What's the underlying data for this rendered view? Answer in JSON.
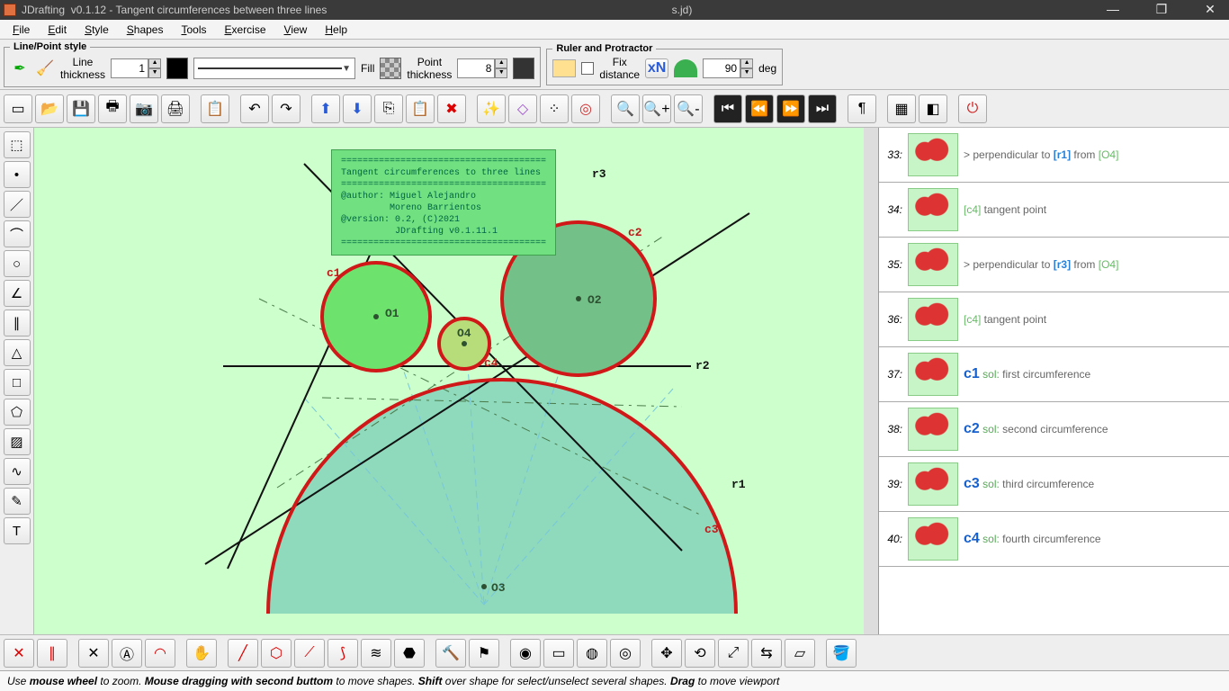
{
  "window": {
    "app_name": "JDrafting",
    "version": "v0.1.12",
    "doc_title": "Tangent circumferences between three lines",
    "file_suffix": "s.jd)"
  },
  "menus": [
    "File",
    "Edit",
    "Style",
    "Shapes",
    "Tools",
    "Exercise",
    "View",
    "Help"
  ],
  "line_point_style": {
    "legend": "Line/Point style",
    "thickness_label": "Line\nthickness",
    "thickness_value": "1",
    "color": "#000000",
    "fill_label": "Fill",
    "point_thickness_label": "Point\nthickness",
    "point_thickness_value": "8",
    "point_color": "#333333"
  },
  "ruler_protractor": {
    "legend": "Ruler and Protractor",
    "fix_distance_label": "Fix\ndistance",
    "xn_label": "xN",
    "angle_value": "90",
    "angle_unit": "deg"
  },
  "main_toolbar_icons": [
    {
      "name": "new-icon",
      "glyph": "▭"
    },
    {
      "name": "open-icon",
      "glyph": "📂"
    },
    {
      "name": "save-icon",
      "glyph": "💾"
    },
    {
      "name": "print-icon",
      "glyph": "🖶"
    },
    {
      "name": "camera-icon",
      "glyph": "📷"
    },
    {
      "name": "printer2-icon",
      "glyph": "🖨"
    },
    {
      "sep": true
    },
    {
      "name": "paste-icon",
      "glyph": "📋"
    },
    {
      "sep": true
    },
    {
      "name": "undo-icon",
      "glyph": "↶"
    },
    {
      "name": "redo-icon",
      "glyph": "↷"
    },
    {
      "sep": true
    },
    {
      "name": "up-icon",
      "glyph": "⬆",
      "color": "#2a5bd7"
    },
    {
      "name": "down-icon",
      "glyph": "⬇",
      "color": "#2a5bd7"
    },
    {
      "name": "copy-icon",
      "glyph": "⎘"
    },
    {
      "name": "clipboard-icon",
      "glyph": "📋"
    },
    {
      "name": "delete-icon",
      "glyph": "✖",
      "color": "#d00"
    },
    {
      "sep": true
    },
    {
      "name": "wand-icon",
      "glyph": "✨"
    },
    {
      "name": "diamond-icon",
      "glyph": "◇",
      "color": "#a050d0"
    },
    {
      "name": "dots-icon",
      "glyph": "⁘"
    },
    {
      "name": "target-icon",
      "glyph": "◎",
      "color": "#d03030"
    },
    {
      "sep": true
    },
    {
      "name": "zoom-fit-icon",
      "glyph": "🔍"
    },
    {
      "name": "zoom-in-icon",
      "glyph": "🔍+"
    },
    {
      "name": "zoom-out-icon",
      "glyph": "🔍-"
    },
    {
      "sep": true
    },
    {
      "name": "first-icon",
      "glyph": "⏮",
      "dark": true
    },
    {
      "name": "prev-icon",
      "glyph": "⏪",
      "dark": true
    },
    {
      "name": "next-icon",
      "glyph": "⏩",
      "dark": true
    },
    {
      "name": "last-icon",
      "glyph": "⏭",
      "dark": true
    },
    {
      "sep": true
    },
    {
      "name": "pilcrow-icon",
      "glyph": "¶"
    },
    {
      "sep": true
    },
    {
      "name": "select-all-icon",
      "glyph": "▦"
    },
    {
      "name": "invert-icon",
      "glyph": "◧"
    },
    {
      "sep": true
    },
    {
      "name": "power-icon",
      "glyph": "⏻",
      "color": "#d02020"
    }
  ],
  "left_tools": [
    {
      "name": "selection-icon",
      "glyph": "⬚"
    },
    {
      "name": "point-icon",
      "glyph": "•"
    },
    {
      "name": "line-icon",
      "glyph": "／"
    },
    {
      "name": "arc-icon",
      "glyph": "⌒"
    },
    {
      "name": "circle-icon",
      "glyph": "○"
    },
    {
      "name": "angle-icon",
      "glyph": "∠"
    },
    {
      "name": "parallel-icon",
      "glyph": "∥"
    },
    {
      "name": "triangle-icon",
      "glyph": "△"
    },
    {
      "name": "square-icon",
      "glyph": "□"
    },
    {
      "name": "polygon-icon",
      "glyph": "⬠"
    },
    {
      "name": "hatch-icon",
      "glyph": "▨"
    },
    {
      "name": "spline-icon",
      "glyph": "∿"
    },
    {
      "name": "pencil-icon",
      "glyph": "✎"
    },
    {
      "name": "text-icon",
      "glyph": "T"
    }
  ],
  "infobox_text": "======================================\nTangent circumferences to three lines\n======================================\n@author: Miguel Alejandro\n         Moreno Barrientos\n@version: 0.2, (C)2021\n          JDrafting v0.1.11.1\n======================================",
  "canvas_labels": {
    "o1": "O1",
    "o2": "O2",
    "o3": "O3",
    "o4": "O4",
    "c1": "c1",
    "c2": "c2",
    "c3": "c3",
    "c4": "c4",
    "r1": "r1",
    "r2": "r2",
    "r3": "r3"
  },
  "steps": [
    {
      "n": "33",
      "kind": "perp",
      "text1": "> perpendicular to ",
      "ref": "[r1]",
      "text2": " from ",
      "src": "[O4]"
    },
    {
      "n": "34",
      "kind": "tan",
      "src": "[c4]",
      "text": " tangent point"
    },
    {
      "n": "35",
      "kind": "perp",
      "text1": "> perpendicular to ",
      "ref": "[r3]",
      "text2": " from ",
      "src": "[O4]"
    },
    {
      "n": "36",
      "kind": "tan",
      "src": "[c4]",
      "text": " tangent point"
    },
    {
      "n": "37",
      "kind": "sol",
      "cname": "c1",
      "text": " first circumference"
    },
    {
      "n": "38",
      "kind": "sol",
      "cname": "c2",
      "text": " second circumference"
    },
    {
      "n": "39",
      "kind": "sol",
      "cname": "c3",
      "text": " third circumference"
    },
    {
      "n": "40",
      "kind": "sol",
      "cname": "c4",
      "text": " fourth circumference"
    }
  ],
  "bottom_tools": [
    {
      "name": "intersect-icon",
      "glyph": "✕",
      "color": "#d00"
    },
    {
      "name": "parallel2-icon",
      "glyph": "∥",
      "color": "#d00"
    },
    {
      "sep": true
    },
    {
      "name": "bisector-icon",
      "glyph": "✕"
    },
    {
      "name": "compass-icon",
      "glyph": "Ⓐ"
    },
    {
      "name": "arc2-icon",
      "glyph": "◠",
      "color": "#d00"
    },
    {
      "sep": true
    },
    {
      "name": "hand-icon",
      "glyph": "✋"
    },
    {
      "sep": true
    },
    {
      "name": "seg-icon",
      "glyph": "╱",
      "color": "#d00"
    },
    {
      "name": "hex-icon",
      "glyph": "⬡",
      "color": "#d00"
    },
    {
      "name": "seg2-icon",
      "glyph": "⟋",
      "color": "#d00"
    },
    {
      "name": "arc3-icon",
      "glyph": "⟆",
      "color": "#d00"
    },
    {
      "name": "wave-icon",
      "glyph": "≋"
    },
    {
      "name": "hex2-icon",
      "glyph": "⬣"
    },
    {
      "sep": true
    },
    {
      "name": "hammer-icon",
      "glyph": "🔨"
    },
    {
      "name": "flag-icon",
      "glyph": "⚑"
    },
    {
      "sep": true
    },
    {
      "name": "overlap-icon",
      "glyph": "◉"
    },
    {
      "name": "rect-icon",
      "glyph": "▭"
    },
    {
      "name": "circles-icon",
      "glyph": "◍"
    },
    {
      "name": "circles2-icon",
      "glyph": "◎"
    },
    {
      "sep": true
    },
    {
      "name": "move-icon",
      "glyph": "✥"
    },
    {
      "name": "rotate-icon",
      "glyph": "⟲"
    },
    {
      "name": "scale-icon",
      "glyph": "⤢"
    },
    {
      "name": "mirror-icon",
      "glyph": "⇆"
    },
    {
      "name": "skew-icon",
      "glyph": "▱"
    },
    {
      "sep": true
    },
    {
      "name": "bucket-icon",
      "glyph": "🪣"
    }
  ],
  "status": {
    "t1": "Use ",
    "b1": "mouse wheel",
    "t2": " to zoom. ",
    "b2": "Mouse dragging with second buttom",
    "t3": " to move shapes. ",
    "b3": "Shift",
    "t4": " over shape for select/unselect several shapes. ",
    "b4": "Drag",
    "t5": " to move viewport"
  }
}
